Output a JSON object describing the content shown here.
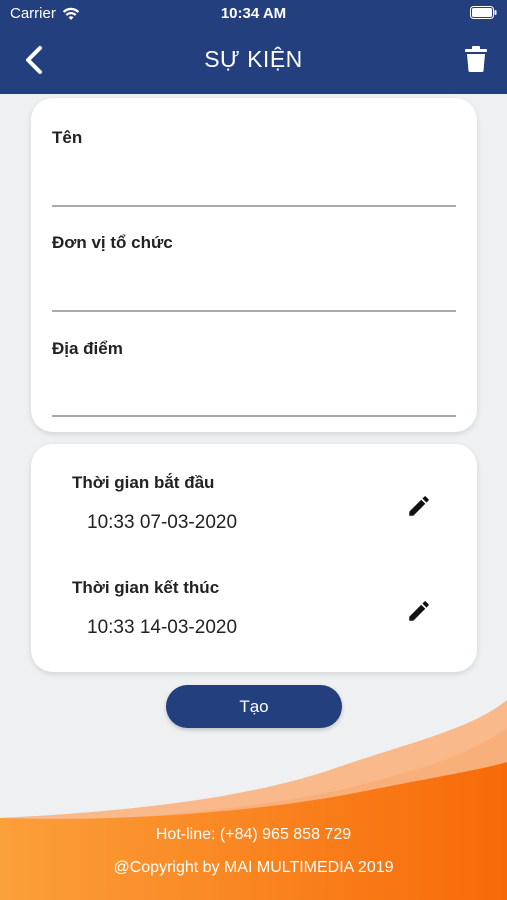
{
  "status_bar": {
    "carrier": "Carrier",
    "time": "10:34 AM"
  },
  "nav": {
    "title": "SỰ KIỆN",
    "back_icon": "chevron-left-icon",
    "trash_icon": "trash-icon"
  },
  "form": {
    "fields": [
      {
        "label": "Tên",
        "value": ""
      },
      {
        "label": "Đơn vị tổ chức",
        "value": ""
      },
      {
        "label": "Địa điểm",
        "value": ""
      }
    ]
  },
  "times": {
    "start_label": "Thời gian bắt đầu",
    "start_value": "10:33 07-03-2020",
    "end_label": "Thời gian kết thúc",
    "end_value": "10:33 14-03-2020",
    "edit_icon": "pencil-icon"
  },
  "actions": {
    "create_label": "Tạo"
  },
  "footer": {
    "hotline": "Hot-line: (+84) 965 858 729",
    "copyright": "@Copyright by MAI MULTIMEDIA 2019"
  },
  "colors": {
    "primary": "#233f7e",
    "accent_orange": "#f7760f",
    "accent_peach": "#f9b98a",
    "background": "#eef0f2"
  }
}
